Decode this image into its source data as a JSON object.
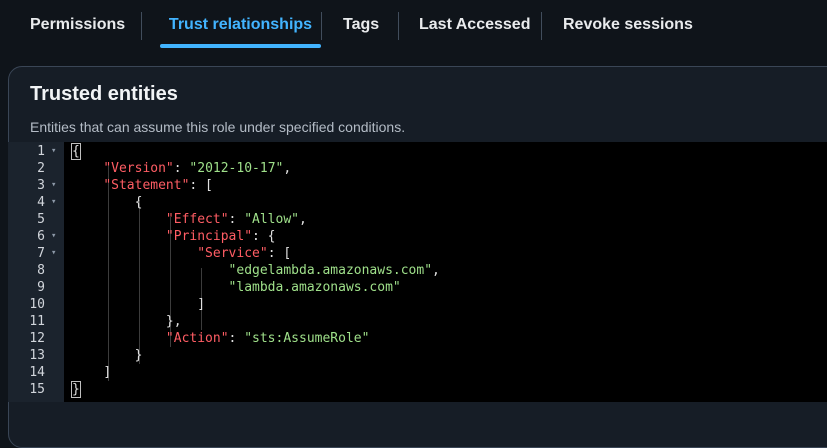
{
  "tabs": [
    {
      "label": "Permissions",
      "active": false
    },
    {
      "label": "Trust relationships",
      "active": true
    },
    {
      "label": "Tags",
      "active": false
    },
    {
      "label": "Last Accessed",
      "active": false
    },
    {
      "label": "Revoke sessions",
      "active": false
    }
  ],
  "panel": {
    "title": "Trusted entities",
    "description": "Entities that can assume this role under specified conditions."
  },
  "editor": {
    "lines": [
      {
        "n": "1",
        "fold": true
      },
      {
        "n": "2",
        "fold": false
      },
      {
        "n": "3",
        "fold": true
      },
      {
        "n": "4",
        "fold": true
      },
      {
        "n": "5",
        "fold": false
      },
      {
        "n": "6",
        "fold": true
      },
      {
        "n": "7",
        "fold": true
      },
      {
        "n": "8",
        "fold": false
      },
      {
        "n": "9",
        "fold": false
      },
      {
        "n": "10",
        "fold": false
      },
      {
        "n": "11",
        "fold": false
      },
      {
        "n": "12",
        "fold": false
      },
      {
        "n": "13",
        "fold": false
      },
      {
        "n": "14",
        "fold": false
      },
      {
        "n": "15",
        "fold": false
      }
    ],
    "tokens": {
      "open_brace": "{",
      "close_brace": "}",
      "version_key": "\"Version\"",
      "version_val": "\"2012-10-17\"",
      "statement_key": "\"Statement\"",
      "effect_key": "\"Effect\"",
      "effect_val": "\"Allow\"",
      "principal_key": "\"Principal\"",
      "service_key": "\"Service\"",
      "service_1": "\"edgelambda.amazonaws.com\"",
      "service_2": "\"lambda.amazonaws.com\"",
      "action_key": "\"Action\"",
      "action_val": "\"sts:AssumeRole\""
    }
  }
}
